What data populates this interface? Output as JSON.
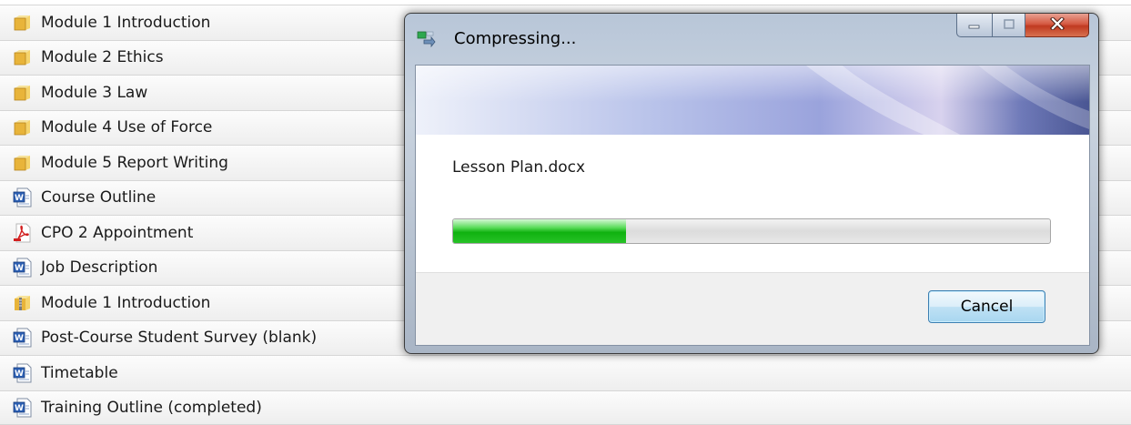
{
  "files": [
    {
      "name": "Module 1 Introduction",
      "icon": "folder-icon"
    },
    {
      "name": "Module 2 Ethics",
      "icon": "folder-icon"
    },
    {
      "name": "Module 3 Law",
      "icon": "folder-icon"
    },
    {
      "name": "Module 4 Use of Force",
      "icon": "folder-icon"
    },
    {
      "name": "Module 5 Report Writing",
      "icon": "folder-icon"
    },
    {
      "name": "Course Outline",
      "icon": "word-doc-icon"
    },
    {
      "name": "CPO 2 Appointment",
      "icon": "pdf-icon"
    },
    {
      "name": "Job Description",
      "icon": "word-doc-icon"
    },
    {
      "name": "Module 1 Introduction",
      "icon": "zip-folder-icon"
    },
    {
      "name": "Post-Course Student Survey (blank)",
      "icon": "word-doc-icon"
    },
    {
      "name": "Timetable",
      "icon": "word-doc-icon"
    },
    {
      "name": "Training Outline (completed)",
      "icon": "word-doc-icon"
    }
  ],
  "dialog": {
    "title": "Compressing...",
    "title_icon": "compress-icon",
    "current_file": "Lesson Plan.docx",
    "progress": 0.29,
    "cancel_label": "Cancel",
    "window_buttons": [
      "minimize-icon",
      "maximize-icon",
      "close-icon"
    ]
  },
  "colors": {
    "progress_fill": "#10b210",
    "close_button": "#c03a21",
    "cancel_border": "#3c7fb1"
  }
}
